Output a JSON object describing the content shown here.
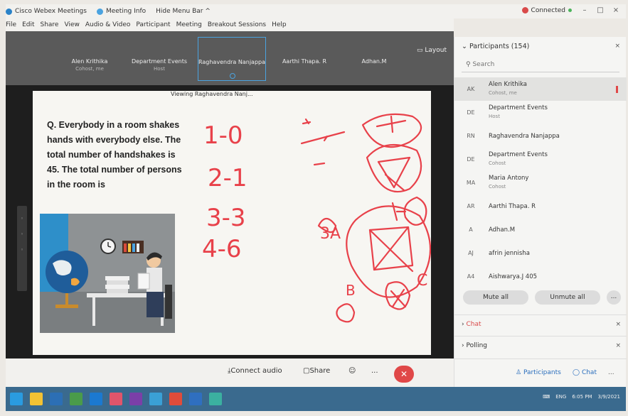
{
  "titlebar": {
    "app": "Cisco Webex Meetings",
    "meeting_info": "Meeting Info",
    "hide_menu": "Hide Menu Bar ^",
    "status": "Connected",
    "win_min": "–",
    "win_max": "□",
    "win_close": "×"
  },
  "menu": [
    "File",
    "Edit",
    "Share",
    "View",
    "Audio & Video",
    "Participant",
    "Meeting",
    "Breakout Sessions",
    "Help"
  ],
  "thumbs": [
    {
      "name": "Alen Krithika",
      "role": "Cohost, me"
    },
    {
      "name": "Department Events",
      "role": "Host"
    },
    {
      "name": "Raghavendra Nanjappa",
      "role": ""
    },
    {
      "name": "Aarthi Thapa. R",
      "role": ""
    },
    {
      "name": "Adhan.M",
      "role": ""
    }
  ],
  "layout_label": "Layout",
  "viewing": "Viewing Raghavendra Nanj...",
  "slide": {
    "question": "Q. Everybody in a room shakes hands with everybody else. The total number of handshakes is 45. The total number of persons in the room is"
  },
  "annotations": {
    "col1": [
      "1-0",
      "2-1",
      "3-3",
      "4-6"
    ],
    "label_3a": "3A",
    "label_b": "B",
    "label_c": "C",
    "color": "#e8414a"
  },
  "controls": {
    "audio": "Connect audio",
    "share": "Share",
    "reactions_icon": "☺",
    "more": "...",
    "end_icon": "✕"
  },
  "panel": {
    "title": "Participants (154)",
    "close": "×",
    "search_placeholder": "Search",
    "participants": [
      {
        "initials": "AK",
        "name": "Alen Krithika",
        "role": "Cohost, me",
        "selected": true
      },
      {
        "initials": "DE",
        "name": "Department Events",
        "role": "Host"
      },
      {
        "initials": "RN",
        "name": "Raghavendra Nanjappa",
        "role": ""
      },
      {
        "initials": "DE",
        "name": "Department Events",
        "role": "Cohost"
      },
      {
        "initials": "MA",
        "name": "Maria Antony",
        "role": "Cohost"
      },
      {
        "initials": "AR",
        "name": "Aarthi Thapa. R",
        "role": ""
      },
      {
        "initials": "A",
        "name": "Adhan.M",
        "role": ""
      },
      {
        "initials": "AJ",
        "name": "afrin jennisha",
        "role": ""
      },
      {
        "initials": "A4",
        "name": "Aishwarya.J 405",
        "role": ""
      }
    ],
    "mute_all": "Mute all",
    "unmute_all": "Unmute all",
    "more": "...",
    "chat_section": "Chat",
    "polling_section": "Polling",
    "footer_participants": "Participants",
    "footer_chat": "Chat",
    "footer_more": "..."
  },
  "taskbar": {
    "lang": "ENG",
    "time": "6:05 PM",
    "date": "3/9/2021"
  },
  "colors": {
    "accent": "#2a82c8",
    "end_red": "#e04848",
    "ink": "#e8414a"
  }
}
